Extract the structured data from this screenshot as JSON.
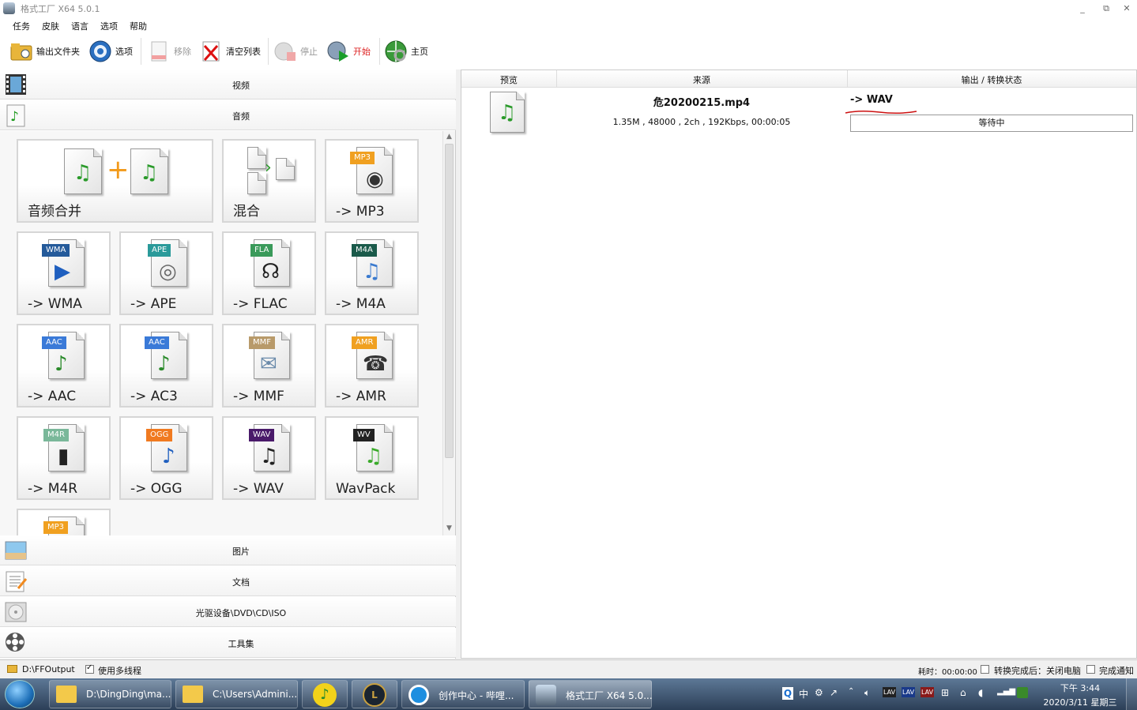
{
  "window": {
    "title": "格式工厂 X64 5.0.1",
    "buttons": [
      "_",
      "⧉",
      "✕"
    ]
  },
  "menu": [
    "任务",
    "皮肤",
    "语言",
    "选项",
    "帮助"
  ],
  "toolbar": {
    "output_folder": "输出文件夹",
    "options": "选项",
    "remove": "移除",
    "clear_list": "清空列表",
    "stop": "停止",
    "start": "开始",
    "home": "主页"
  },
  "categories": {
    "video": "视频",
    "audio": "音频",
    "image": "图片",
    "document": "文档",
    "rom": "光驱设备\\DVD\\CD\\ISO",
    "tools": "工具集"
  },
  "tiles": [
    {
      "label": "音频合并"
    },
    {
      "label": "混合"
    },
    {
      "label": "-> MP3",
      "badge": "MP3"
    },
    {
      "label": "-> WMA",
      "badge": "WMA"
    },
    {
      "label": "-> APE",
      "badge": "APE"
    },
    {
      "label": "-> FLAC",
      "badge": "FLA"
    },
    {
      "label": "-> M4A",
      "badge": "M4A"
    },
    {
      "label": "-> AAC",
      "badge": "AAC"
    },
    {
      "label": "-> AC3",
      "badge": "AAC"
    },
    {
      "label": "-> MMF",
      "badge": "MMF"
    },
    {
      "label": "-> AMR",
      "badge": "AMR"
    },
    {
      "label": "-> M4R",
      "badge": "M4R"
    },
    {
      "label": "-> OGG",
      "badge": "OGG"
    },
    {
      "label": "-> WAV",
      "badge": "WAV"
    },
    {
      "label": "WavPack",
      "badge": "WV"
    },
    {
      "label": "",
      "badge": "MP3"
    }
  ],
  "task_table": {
    "headers": [
      "预览",
      "来源",
      "输出 / 转换状态"
    ],
    "row": {
      "filename": "危20200215.mp4",
      "info": "1.35M , 48000 , 2ch , 192Kbps, 00:00:05",
      "output": "-> WAV",
      "status": "等待中"
    }
  },
  "statusbar": {
    "output_path": "D:\\FFOutput",
    "multithread": "使用多线程",
    "elapsed": "耗时：00:00:00",
    "after_complete": "转换完成后：关闭电脑",
    "notify": "完成通知"
  },
  "taskbar": {
    "items": [
      "D:\\DingDing\\ma...",
      "C:\\Users\\Admini...",
      "创作中心 - 哔哩...",
      "格式工厂 X64 5.0..."
    ],
    "tray_icons": [
      "中",
      "LAV",
      "LAV",
      "LAV"
    ],
    "time": "下午 3:44",
    "date": "2020/3/11 星期三"
  },
  "colors": {
    "start": "#d22222",
    "annotation": "#cc1111",
    "taskbar": "#3b5270"
  }
}
